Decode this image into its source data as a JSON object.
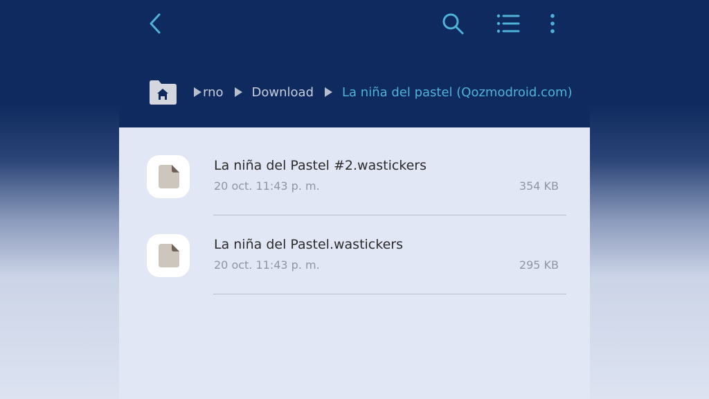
{
  "colors": {
    "appbar_bg": "#0f2a5e",
    "accent": "#4fb3d9",
    "list_bg": "#e1e7f5"
  },
  "toolbar": {
    "back_icon": "chevron-left-icon",
    "search_icon": "search-icon",
    "list_view_icon": "list-view-icon",
    "more_icon": "more-vertical-icon"
  },
  "breadcrumb": {
    "home_icon": "home-folder-icon",
    "items": [
      {
        "label": "rno"
      },
      {
        "label": "Download"
      },
      {
        "label": "La niña del pastel (Qozmodroid.com)"
      }
    ]
  },
  "files": [
    {
      "name": "La niña del Pastel #2.wastickers",
      "date": "20 oct. 11:43 p. m.",
      "size": "354 KB"
    },
    {
      "name": "La niña del Pastel.wastickers",
      "date": "20 oct. 11:43 p. m.",
      "size": "295 KB"
    }
  ]
}
